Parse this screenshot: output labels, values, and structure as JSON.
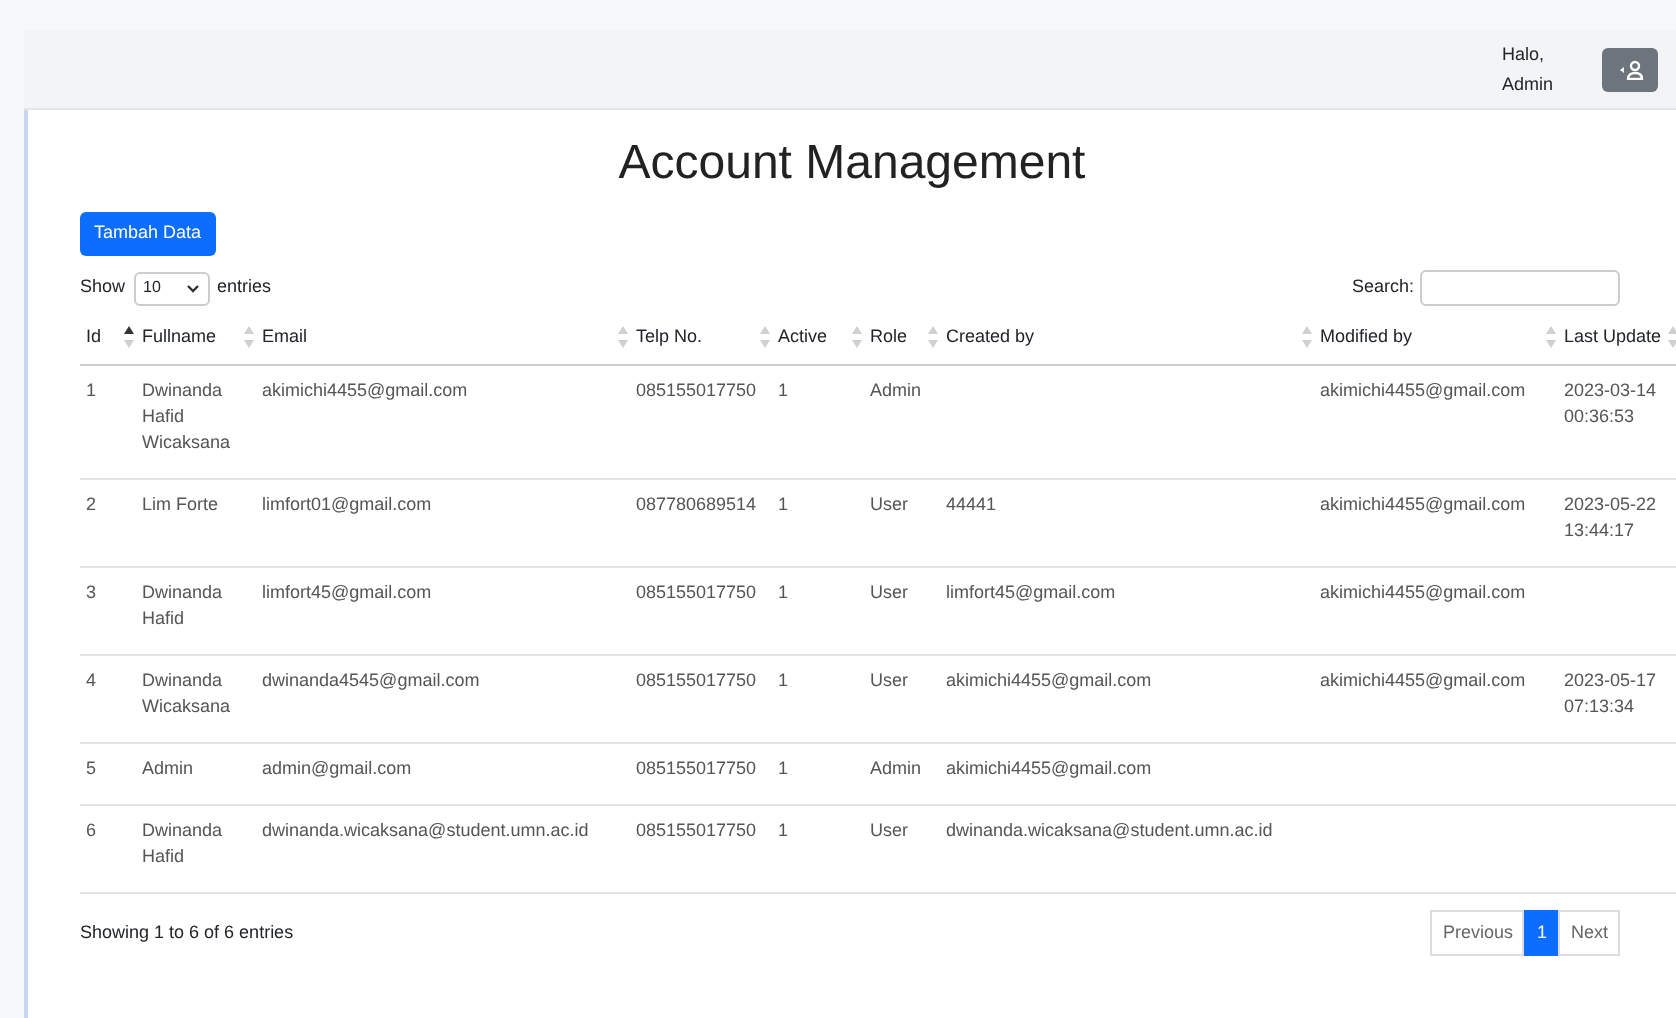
{
  "header": {
    "greeting": "Halo, Admin"
  },
  "title": "Account Management",
  "add_button": "Tambah Data",
  "length_control": {
    "before": "Show",
    "value": "10",
    "after": "entries"
  },
  "search": {
    "label": "Search:"
  },
  "table": {
    "columns": [
      {
        "label": "Id",
        "sorted": true
      },
      {
        "label": "Fullname",
        "sorted": false
      },
      {
        "label": "Email",
        "sorted": false
      },
      {
        "label": "Telp No.",
        "sorted": false
      },
      {
        "label": "Active",
        "sorted": false
      },
      {
        "label": "Role",
        "sorted": false
      },
      {
        "label": "Created by",
        "sorted": false
      },
      {
        "label": "Modified by",
        "sorted": false
      },
      {
        "label": "Last Update",
        "sorted": false
      }
    ],
    "rows": [
      [
        "1",
        "Dwinanda Hafid Wicaksana",
        "akimichi4455@gmail.com",
        "085155017750",
        "1",
        "Admin",
        "",
        "akimichi4455@gmail.com",
        "2023-03-14 00:36:53"
      ],
      [
        "2",
        "Lim Forte",
        "limfort01@gmail.com",
        "087780689514",
        "1",
        "User",
        "44441",
        "akimichi4455@gmail.com",
        "2023-05-22 13:44:17"
      ],
      [
        "3",
        "Dwinanda Hafid",
        "limfort45@gmail.com",
        "085155017750",
        "1",
        "User",
        "limfort45@gmail.com",
        "akimichi4455@gmail.com",
        ""
      ],
      [
        "4",
        "Dwinanda Wicaksana",
        "dwinanda4545@gmail.com",
        "085155017750",
        "1",
        "User",
        "akimichi4455@gmail.com",
        "akimichi4455@gmail.com",
        "2023-05-17 07:13:34"
      ],
      [
        "5",
        "Admin",
        "admin@gmail.com",
        "085155017750",
        "1",
        "Admin",
        "akimichi4455@gmail.com",
        "",
        ""
      ],
      [
        "6",
        "Dwinanda Hafid",
        "dwinanda.wicaksana@student.umn.ac.id",
        "085155017750",
        "1",
        "User",
        "dwinanda.wicaksana@student.umn.ac.id",
        "",
        ""
      ]
    ]
  },
  "info": "Showing 1 to 6 of 6 entries",
  "pagination": [
    {
      "label": "Previous",
      "selected": false
    },
    {
      "label": "1",
      "selected": true
    },
    {
      "label": "Next",
      "selected": false
    }
  ]
}
